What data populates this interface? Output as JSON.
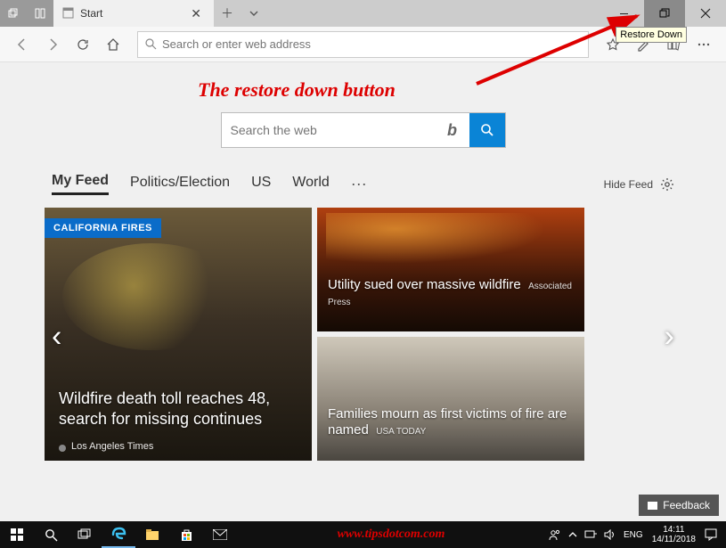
{
  "titlebar": {
    "tab_title": "Start",
    "restore_tooltip": "Restore Down"
  },
  "navbar": {
    "address_placeholder": "Search or enter web address"
  },
  "annotation": {
    "text": "The restore down button"
  },
  "content_search": {
    "placeholder": "Search the web"
  },
  "feednav": {
    "items": [
      "My Feed",
      "Politics/Election",
      "US",
      "World"
    ],
    "hide_feed": "Hide Feed"
  },
  "tiles": {
    "badge": "CALIFORNIA FIRES",
    "big": {
      "headline": "Wildfire death toll reaches 48, search for missing continues",
      "source": "Los Angeles Times"
    },
    "top": {
      "headline": "Utility sued over massive wildfire",
      "source": "Associated Press"
    },
    "bot": {
      "headline": "Families mourn as first victims of fire are named",
      "source": "USA TODAY"
    }
  },
  "feedback": {
    "label": "Feedback"
  },
  "taskbar": {
    "watermark": "www.tipsdotcom.com",
    "lang": "ENG",
    "time": "14:11",
    "date": "14/11/2018"
  }
}
